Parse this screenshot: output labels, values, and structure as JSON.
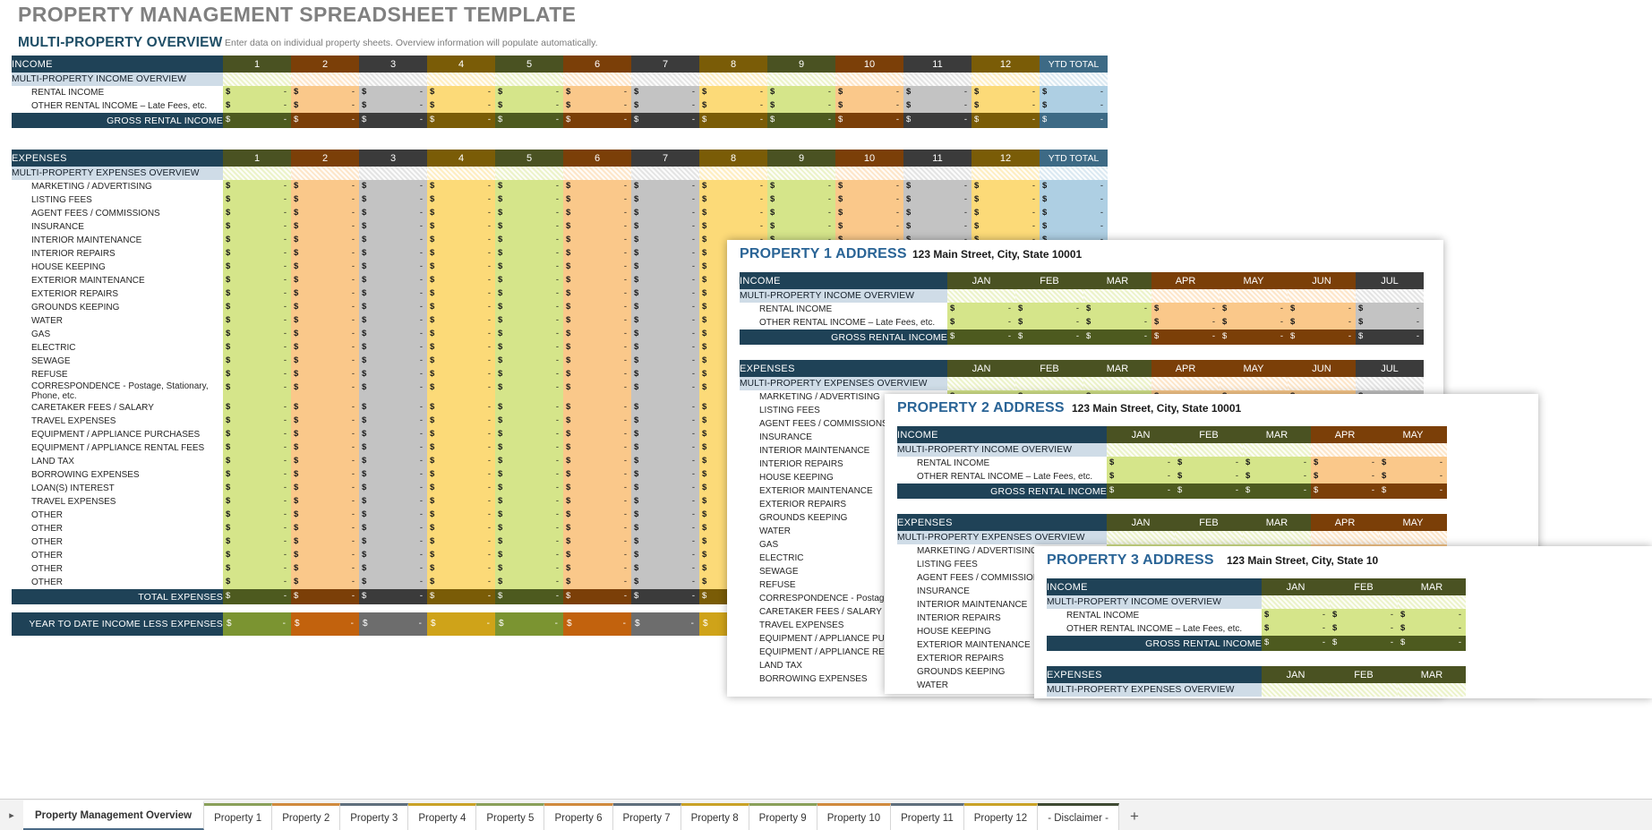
{
  "document": {
    "title": "PROPERTY MANAGEMENT SPREADSHEET TEMPLATE",
    "section_title": "MULTI-PROPERTY OVERVIEW",
    "section_note": "Enter data on individual property sheets.  Overview information will populate automatically."
  },
  "overview": {
    "income_header": "INCOME",
    "expenses_header": "EXPENSES",
    "ytd_total_header": "YTD TOTAL",
    "columns": [
      "1",
      "2",
      "3",
      "4",
      "5",
      "6",
      "7",
      "8",
      "9",
      "10",
      "11",
      "12"
    ],
    "income_subheader": "MULTI-PROPERTY INCOME OVERVIEW",
    "income_rows": [
      "RENTAL INCOME",
      "OTHER RENTAL INCOME  – Late Fees, etc."
    ],
    "gross_rental_income_label": "GROSS RENTAL INCOME",
    "expenses_subheader": "MULTI-PROPERTY EXPENSES OVERVIEW",
    "expense_rows": [
      "MARKETING / ADVERTISING",
      "LISTING FEES",
      "AGENT FEES / COMMISSIONS",
      "INSURANCE",
      "INTERIOR MAINTENANCE",
      "INTERIOR REPAIRS",
      "HOUSE KEEPING",
      "EXTERIOR MAINTENANCE",
      "EXTERIOR REPAIRS",
      "GROUNDS KEEPING",
      "WATER",
      "GAS",
      "ELECTRIC",
      "SEWAGE",
      "REFUSE",
      "CORRESPONDENCE - Postage, Stationary, Phone, etc.",
      "CARETAKER FEES / SALARY",
      "TRAVEL EXPENSES",
      "EQUIPMENT / APPLIANCE PURCHASES",
      "EQUIPMENT / APPLIANCE RENTAL FEES",
      "LAND TAX",
      "BORROWING EXPENSES",
      "LOAN(S) INTEREST",
      "TRAVEL EXPENSES",
      "OTHER",
      "OTHER",
      "OTHER",
      "OTHER",
      "OTHER",
      "OTHER"
    ],
    "total_expenses_label": "TOTAL EXPENSES",
    "ytd_income_less_expenses_label": "YEAR TO DATE INCOME LESS EXPENSES",
    "currency_symbol": "$",
    "empty_value": "-"
  },
  "property_windows": [
    {
      "title": "PROPERTY 1 ADDRESS",
      "address": "123 Main Street, City, State  10001",
      "income_header": "INCOME",
      "expenses_header": "EXPENSES",
      "months": [
        "JAN",
        "FEB",
        "MAR",
        "APR",
        "MAY",
        "JUN",
        "JUL"
      ],
      "income_subheader": "MULTI-PROPERTY INCOME OVERVIEW",
      "income_rows": [
        "RENTAL INCOME",
        "OTHER RENTAL INCOME  – Late Fees, etc."
      ],
      "gross_rental_income_label": "GROSS RENTAL INCOME",
      "expenses_subheader": "MULTI-PROPERTY EXPENSES OVERVIEW",
      "expense_rows": [
        "MARKETING / ADVERTISING",
        "LISTING FEES",
        "AGENT FEES / COMMISSIONS",
        "INSURANCE",
        "INTERIOR MAINTENANCE",
        "INTERIOR REPAIRS",
        "HOUSE KEEPING",
        "EXTERIOR MAINTENANCE",
        "EXTERIOR REPAIRS",
        "GROUNDS KEEPING",
        "WATER",
        "GAS",
        "ELECTRIC",
        "SEWAGE",
        "REFUSE",
        "CORRESPONDENCE - Postage, Statio",
        "CARETAKER FEES / SALARY",
        "TRAVEL EXPENSES",
        "EQUIPMENT / APPLIANCE PURCHASE",
        "EQUIPMENT / APPLIANCE RENTAL FEE",
        "LAND TAX",
        "BORROWING EXPENSES"
      ]
    },
    {
      "title": "PROPERTY 2 ADDRESS",
      "address": "123 Main Street, City, State  10001",
      "income_header": "INCOME",
      "expenses_header": "EXPENSES",
      "months": [
        "JAN",
        "FEB",
        "MAR",
        "APR",
        "MAY"
      ],
      "income_subheader": "MULTI-PROPERTY INCOME OVERVIEW",
      "income_rows": [
        "RENTAL INCOME",
        "OTHER RENTAL INCOME  – Late Fees, etc."
      ],
      "gross_rental_income_label": "GROSS RENTAL INCOME",
      "expenses_subheader": "MULTI-PROPERTY EXPENSES OVERVIEW",
      "expense_rows": [
        "MARKETING / ADVERTISING",
        "LISTING FEES",
        "AGENT FEES / COMMISSIONS",
        "INSURANCE",
        "INTERIOR MAINTENANCE",
        "INTERIOR REPAIRS",
        "HOUSE KEEPING",
        "EXTERIOR MAINTENANCE",
        "EXTERIOR REPAIRS",
        "GROUNDS KEEPING",
        "WATER"
      ]
    },
    {
      "title": "PROPERTY 3 ADDRESS",
      "address": "123 Main Street, City, State  10",
      "income_header": "INCOME",
      "expenses_header": "EXPENSES",
      "months": [
        "JAN",
        "FEB",
        "MAR"
      ],
      "income_subheader": "MULTI-PROPERTY INCOME OVERVIEW",
      "income_rows": [
        "RENTAL INCOME",
        "OTHER RENTAL INCOME  – Late Fees, etc."
      ],
      "gross_rental_income_label": "GROSS RENTAL INCOME",
      "expenses_subheader": "MULTI-PROPERTY EXPENSES OVERVIEW",
      "expense_rows": []
    }
  ],
  "tabbar": {
    "nav_icon": "▸",
    "add_label": "+",
    "tabs": [
      {
        "label": "Property Management Overview",
        "active": true,
        "color": "#ffffff"
      },
      {
        "label": "Property 1",
        "active": false,
        "color": "#8aa05a"
      },
      {
        "label": "Property 2",
        "active": false,
        "color": "#d08a3e"
      },
      {
        "label": "Property 3",
        "active": false,
        "color": "#5f6f7d"
      },
      {
        "label": "Property 4",
        "active": false,
        "color": "#c9a227"
      },
      {
        "label": "Property 5",
        "active": false,
        "color": "#8aa05a"
      },
      {
        "label": "Property 6",
        "active": false,
        "color": "#d08a3e"
      },
      {
        "label": "Property 7",
        "active": false,
        "color": "#5f6f7d"
      },
      {
        "label": "Property 8",
        "active": false,
        "color": "#c9a227"
      },
      {
        "label": "Property 9",
        "active": false,
        "color": "#8aa05a"
      },
      {
        "label": "Property 10",
        "active": false,
        "color": "#d08a3e"
      },
      {
        "label": "Property 11",
        "active": false,
        "color": "#5f6f7d"
      },
      {
        "label": "Property 12",
        "active": false,
        "color": "#c9a227"
      },
      {
        "label": "- Disclaimer -",
        "active": false,
        "color": "#3f4a33"
      }
    ]
  },
  "palette": {
    "header_dark_blue": "#1f4257",
    "subheader_blue": "#cfdce7",
    "col_header_cycle": [
      "#4a5222",
      "#7b3f08",
      "#3b3b3b",
      "#7a5c07"
    ],
    "col_cell_cycle": [
      "#d5e58a",
      "#fac88a",
      "#c3c3c3",
      "#fcda78"
    ],
    "total_cycle": [
      "#4d5a1f",
      "#7b3f08",
      "#3b3b3b",
      "#7a5c07"
    ],
    "ytd_cycle": [
      "#7b9431",
      "#c2620d",
      "#6d6d6d",
      "#cfa319"
    ],
    "ytd_col_cell": "#aecfe3",
    "ytd_col_total": "#3d6a85",
    "title_gray": "#808080",
    "accent_blue": "#2a6496"
  }
}
